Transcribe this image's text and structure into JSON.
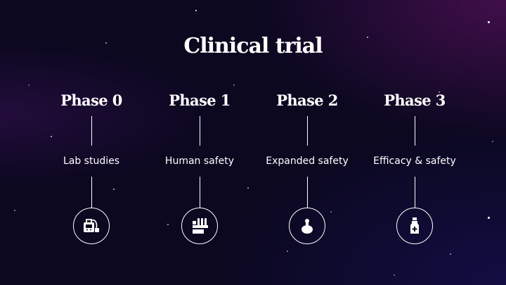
{
  "title": "Clinical trial",
  "phases": [
    {
      "title": "Phase 0",
      "label": "Lab studies",
      "icon": "lab-machine-icon"
    },
    {
      "title": "Phase 1",
      "label": "Human safety",
      "icon": "test-tubes-rack-icon"
    },
    {
      "title": "Phase 2",
      "label": "Expanded safety",
      "icon": "flask-icon"
    },
    {
      "title": "Phase 3",
      "label": "Efficacy & safety",
      "icon": "medicine-bottle-icon"
    }
  ],
  "colors": {
    "background": "#0b0820",
    "text": "#ffffff"
  }
}
